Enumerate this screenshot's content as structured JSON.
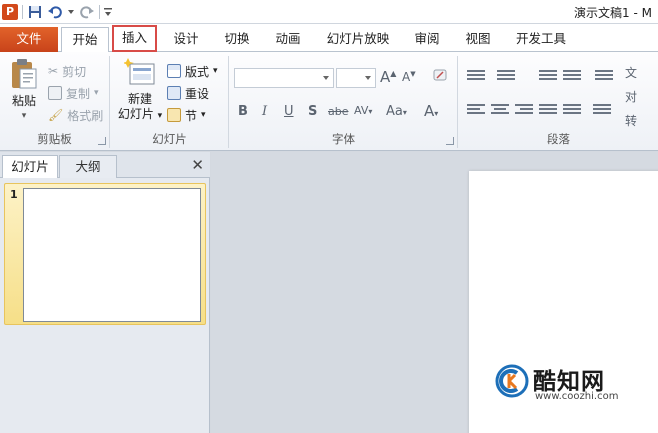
{
  "titlebar": {
    "app_icon_letter": "P",
    "doc_title": "演示文稿1 - M"
  },
  "tabs": [
    {
      "label": "文件"
    },
    {
      "label": "开始"
    },
    {
      "label": "插入"
    },
    {
      "label": "设计"
    },
    {
      "label": "切换"
    },
    {
      "label": "动画"
    },
    {
      "label": "幻灯片放映"
    },
    {
      "label": "审阅"
    },
    {
      "label": "视图"
    },
    {
      "label": "开发工具"
    }
  ],
  "highlighted_tab": "插入",
  "ribbon": {
    "clipboard": {
      "label": "剪贴板",
      "paste": "粘贴",
      "cut": "剪切",
      "copy": "复制",
      "format_painter": "格式刷"
    },
    "slides": {
      "label": "幻灯片",
      "new_slide_line1": "新建",
      "new_slide_line2": "幻灯片",
      "layout": "版式",
      "reset": "重设",
      "section": "节"
    },
    "font": {
      "label": "字体",
      "bold": "B",
      "italic": "I",
      "underline": "U",
      "shadow": "S",
      "strike": "abe",
      "spacing": "AV",
      "case": "Aa",
      "color": "A",
      "grow": "A",
      "shrink": "A"
    },
    "paragraph": {
      "label": "段落",
      "right_cut_1": "文",
      "right_cut_2": "对",
      "right_cut_3": "转"
    }
  },
  "left_pane": {
    "tab_slides": "幻灯片",
    "tab_outline": "大纲",
    "close": "✕",
    "slide_number": "1"
  },
  "watermark": {
    "name": "酷知网",
    "url": "www.coozhi.com"
  },
  "colors": {
    "file_tab": "#d2491b",
    "highlight_box": "#d84b47",
    "thumb_selected": "#f6df88"
  }
}
